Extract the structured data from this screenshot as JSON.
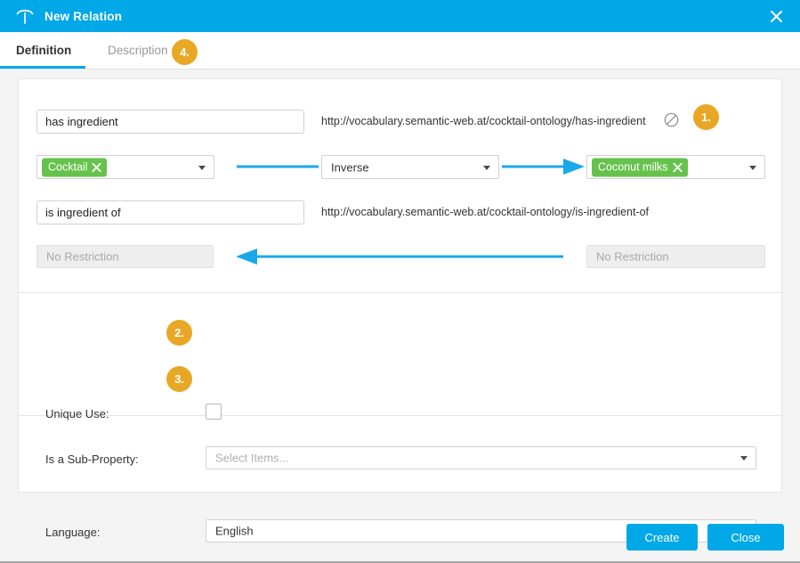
{
  "window": {
    "title": "New Relation",
    "logo_icon": "poolparty-t-icon",
    "close_icon": "close-icon",
    "accent_color": "#00a8e8"
  },
  "tabs": [
    {
      "label": "Definition",
      "active": true
    },
    {
      "label": "Description",
      "active": false
    }
  ],
  "badges": {
    "one": "1.",
    "two": "2.",
    "three": "3.",
    "four": "4.",
    "color": "#e8a825"
  },
  "definition": {
    "forward": {
      "label_value": "has ingredient",
      "label_placeholder": "",
      "uri": "http://vocabulary.semantic-web.at/cocktail-ontology/has-ingredient",
      "uri_lock_icon": "no-edit-circle-slash-icon",
      "domain_tag": "Cocktail",
      "domain_tag_remove_icon": "remove-tag-x-icon",
      "domain_tag_color": "#67c24d",
      "relation_type": "Inverse",
      "range_tag": "Coconut milks",
      "range_tag_remove_icon": "remove-tag-x-icon",
      "range_tag_color": "#67c24d"
    },
    "inverse": {
      "label_value": "is ingredient of",
      "uri": "http://vocabulary.semantic-web.at/cocktail-ontology/is-ingredient-of",
      "left_restriction": "No Restriction",
      "right_restriction": "No Restriction"
    },
    "arrows": {
      "top_direction": "right",
      "bottom_direction": "left",
      "color": "#1ba8e8"
    }
  },
  "options": {
    "unique_use_label": "Unique Use:",
    "unique_use_checked": false,
    "sub_property_label": "Is a Sub-Property:",
    "sub_property_placeholder": "Select Items...",
    "language_label": "Language:",
    "language_value": "English"
  },
  "footer": {
    "create_label": "Create",
    "close_label": "Close"
  }
}
